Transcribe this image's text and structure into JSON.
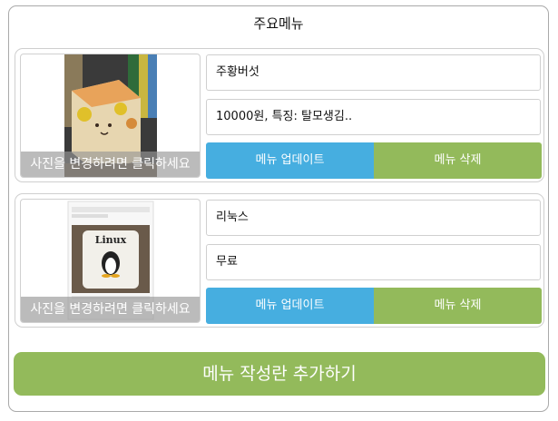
{
  "header": {
    "title": "주요메뉴"
  },
  "menus": [
    {
      "name": "주황버섯",
      "details": "10000원, 특징: 탈모생김..",
      "photo_caption": "사진을 변경하려면 클릭하세요",
      "photo_alt": "orange figurine photo",
      "update_label": "메뉴 업데이트",
      "delete_label": "메뉴 삭제"
    },
    {
      "name": "리눅스",
      "details": "무료",
      "photo_caption": "사진을 변경하려면 클릭하세요",
      "photo_alt": "linux mug photo",
      "photo_mug_text": "Linux",
      "update_label": "메뉴 업데이트",
      "delete_label": "메뉴 삭제"
    }
  ],
  "footer": {
    "add_label": "메뉴 작성란 추가하기"
  },
  "colors": {
    "update": "#46aee0",
    "delete": "#93ba5b",
    "add": "#93ba5b"
  }
}
